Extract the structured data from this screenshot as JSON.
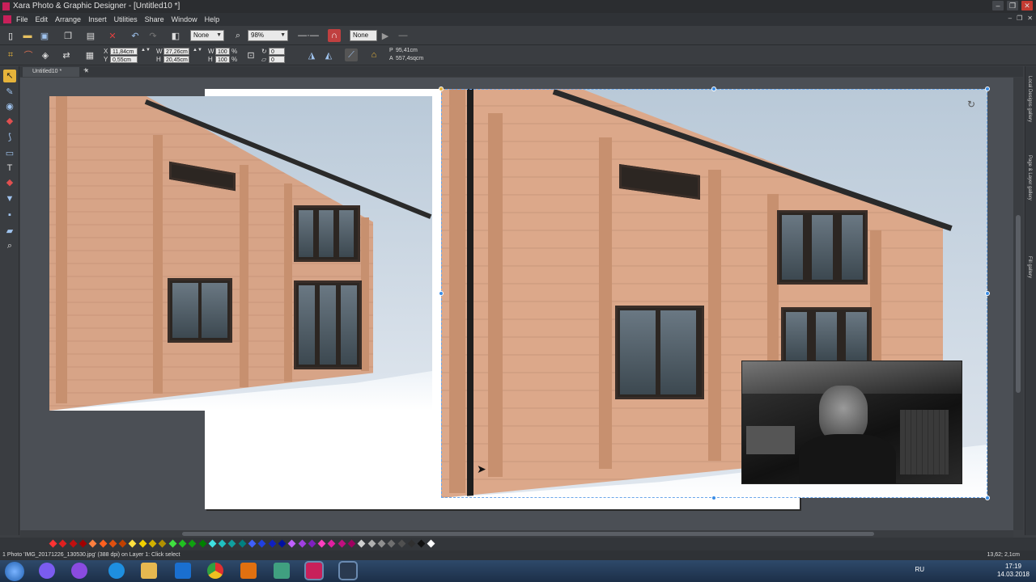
{
  "window": {
    "title": "Xara Photo & Graphic Designer - [Untitled10 *]"
  },
  "menu": [
    "File",
    "Edit",
    "Arrange",
    "Insert",
    "Utilities",
    "Share",
    "Window",
    "Help"
  ],
  "toolbar": {
    "fill_none_1": "None",
    "zoom": "98%",
    "fill_none_2": "None"
  },
  "infobar": {
    "x_label": "X",
    "x_value": "11,84cm",
    "y_label": "Y",
    "y_value": "0,55cm",
    "w_label": "W",
    "w_value": "27,26cm",
    "h_label": "H",
    "h_value": "20,45cm",
    "sw_label": "W",
    "sw_value": "100",
    "sh_label": "H",
    "sh_value": "100",
    "pct": "%",
    "rot_value": "0",
    "skew_value": "0",
    "perimeter_label": "P",
    "perimeter_value": "95,41cm",
    "area_label": "A",
    "area_value": "557,4sqcm"
  },
  "tabs": [
    {
      "label": "Untitled10 *"
    }
  ],
  "galleries": [
    "Local Designs gallery",
    "Page & Layer gallery",
    "Fill gallery"
  ],
  "status": {
    "text": "1 Photo 'IMG_20171226_130530.jpg' (388 dpi) on Layer 1: Click select",
    "coords": "13,62; 2,1cm"
  },
  "taskbar": {
    "lang": "RU",
    "time": "17:19",
    "date": "14.03.2018"
  },
  "colors": {
    "accent": "#e6b33a",
    "selection": "#3a8de6",
    "palette": [
      "#ff3333",
      "#e02020",
      "#c01010",
      "#a00000",
      "#ff8040",
      "#ff6020",
      "#e05010",
      "#c04000",
      "#ffe040",
      "#f0d000",
      "#d0b000",
      "#b09000",
      "#40e040",
      "#20c020",
      "#10a010",
      "#008000",
      "#40e0e0",
      "#20c0c0",
      "#10a0a0",
      "#008080",
      "#4060ff",
      "#2040e0",
      "#1020c0",
      "#0010a0",
      "#c060ff",
      "#a040e0",
      "#8020c0",
      "#ff40c0",
      "#e020a0",
      "#c01080",
      "#a00060",
      "#d0d0d0",
      "#b0b0b0",
      "#909090",
      "#707070",
      "#505050",
      "#303030",
      "#101010",
      "#ffffff"
    ]
  }
}
